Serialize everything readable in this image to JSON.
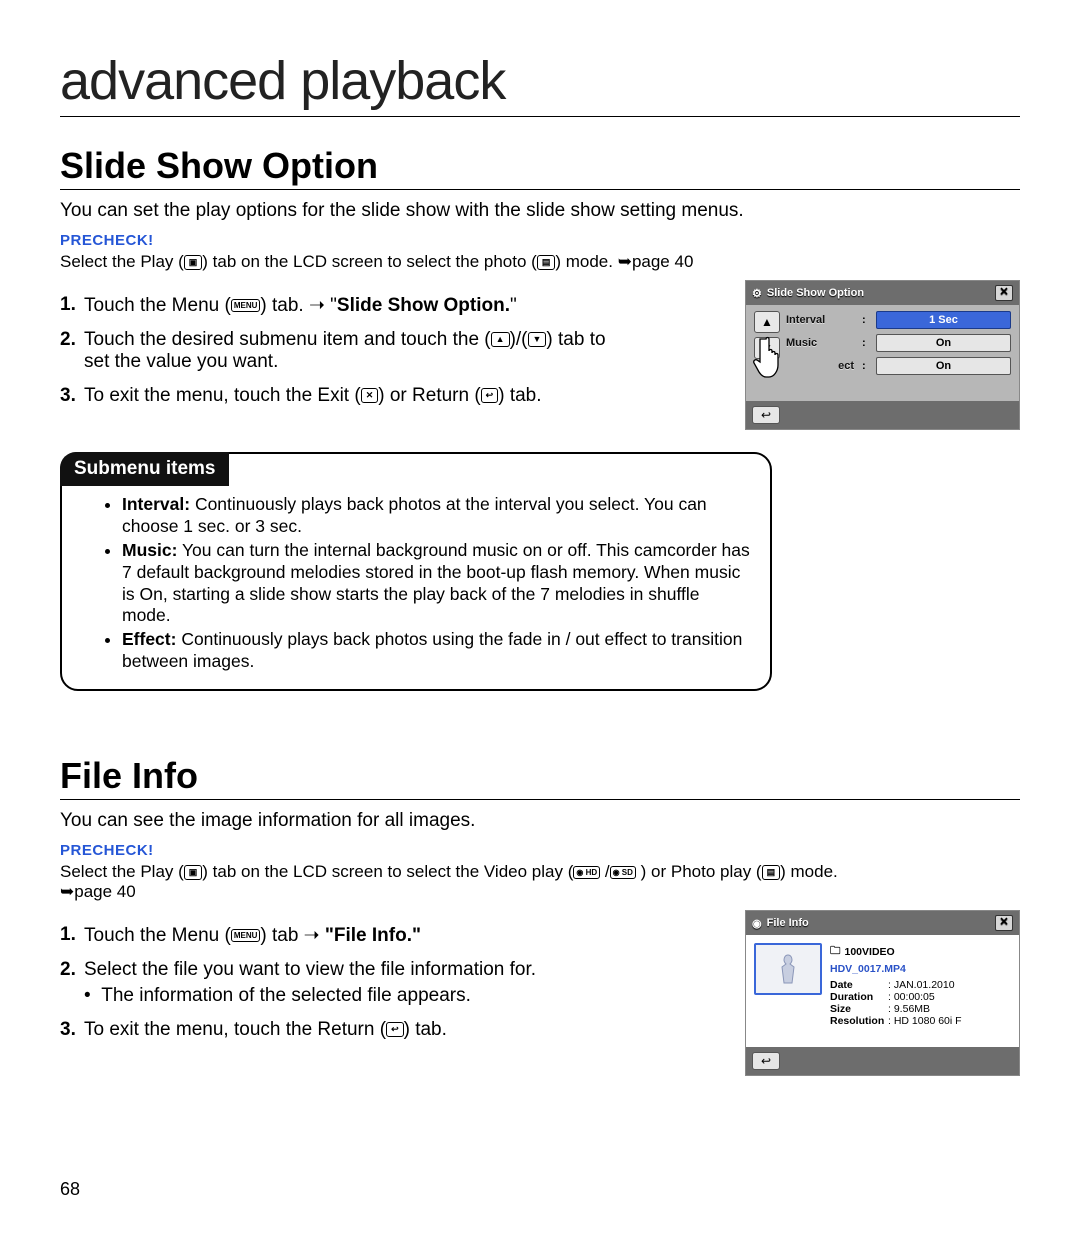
{
  "chapter_title": "advanced playback",
  "page_number": "68",
  "slideShow": {
    "heading": "Slide Show Option",
    "lead": "You can set the play options for the slide show with the slide show setting menus.",
    "precheck_label": "PRECHECK!",
    "precheck_a": "Select the Play (",
    "precheck_b": ") tab on the LCD screen to select the photo (",
    "precheck_c": ") mode. ",
    "precheck_page": "➥page 40",
    "steps": {
      "s1a": "Touch the Menu (",
      "s1b": ") tab. ➝ \"",
      "s1bold": "Slide Show Option.",
      "s1c": "\"",
      "s2a": "Touch the desired submenu item and touch the (",
      "s2b": ")/(",
      "s2c": ") tab to set the value you want.",
      "s3a": "To exit the menu, touch the Exit (",
      "s3b": ") or Return (",
      "s3c": ") tab."
    },
    "submenu": {
      "title": "Submenu items",
      "interval_label": "Interval:",
      "interval_text": " Continuously plays back photos at the interval you select. You can choose 1 sec. or 3 sec.",
      "music_label": "Music:",
      "music_text": " You can turn the internal background music on or off. This camcorder has 7 default background melodies stored in the boot-up flash memory. When music is On, starting a slide show starts the play back of the 7 melodies in shuffle mode.",
      "effect_label": "Effect:",
      "effect_text": " Continuously plays back photos using the fade in / out effect to transition between images."
    },
    "lcd": {
      "title": "Slide Show Option",
      "rows": [
        {
          "name": "Interval",
          "value": "1 Sec",
          "selected": true
        },
        {
          "name": "Music",
          "value": "On",
          "selected": false
        },
        {
          "name": "ect",
          "value": "On",
          "selected": false
        }
      ]
    }
  },
  "fileInfo": {
    "heading": "File Info",
    "lead": "You can see the image information for all images.",
    "precheck_label": "PRECHECK!",
    "precheck_a": "Select the Play (",
    "precheck_b": ") tab on the LCD screen to select the Video play (",
    "precheck_c": ") or Photo play (",
    "precheck_d": ") mode.",
    "precheck_page": "➥page 40",
    "hd_label": "HD",
    "sd_label": "SD",
    "steps": {
      "s1a": "Touch the Menu (",
      "s1b": ") tab ➝ ",
      "s1bold": "\"File Info.\"",
      "s2": "Select the file you want to view the file information for.",
      "s2sub": "The information of the selected file appears.",
      "s3a": "To exit the menu, touch the Return (",
      "s3b": ") tab."
    },
    "lcd": {
      "title": "File Info",
      "folder": "100VIDEO",
      "filename": "HDV_0017.MP4",
      "date_k": "Date",
      "date_v": "JAN.01.2010",
      "dur_k": "Duration",
      "dur_v": "00:00:05",
      "size_k": "Size",
      "size_v": "9.56MB",
      "res_k": "Resolution",
      "res_v": "HD 1080 60i F"
    }
  },
  "icons": {
    "menu": "MENU",
    "play": "▶",
    "photo": "🖼",
    "close": "✕",
    "return": "↩",
    "up": "▲",
    "down": "▼"
  }
}
